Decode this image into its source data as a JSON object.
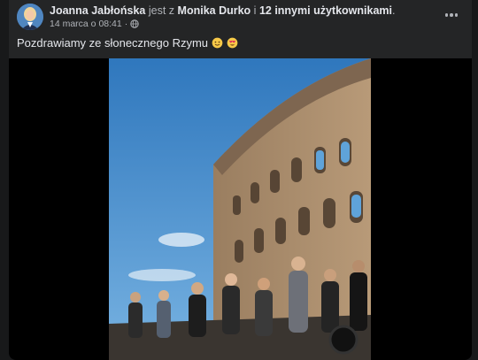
{
  "post": {
    "author": "Joanna Jabłońska",
    "connector": "jest z",
    "tagged_user": "Monika Durko",
    "and_word": "i",
    "others": "12 innymi użytkownikami",
    "period": ".",
    "date": "14 marca o 08:41",
    "separator": "·",
    "audience_icon": "globe-icon",
    "menu_icon": "more-options-icon",
    "caption": "Pozdrawiamy ze słonecznego Rzymu",
    "caption_emojis": [
      "sun-face-emoji",
      "heart-eyes-emoji"
    ]
  },
  "colors": {
    "page_bg": "#18191a",
    "card_bg": "#242526",
    "text_primary": "#e4e6eb",
    "text_secondary": "#b0b3b8",
    "sky": "#4b8ec8",
    "stone": "#a8896a"
  }
}
